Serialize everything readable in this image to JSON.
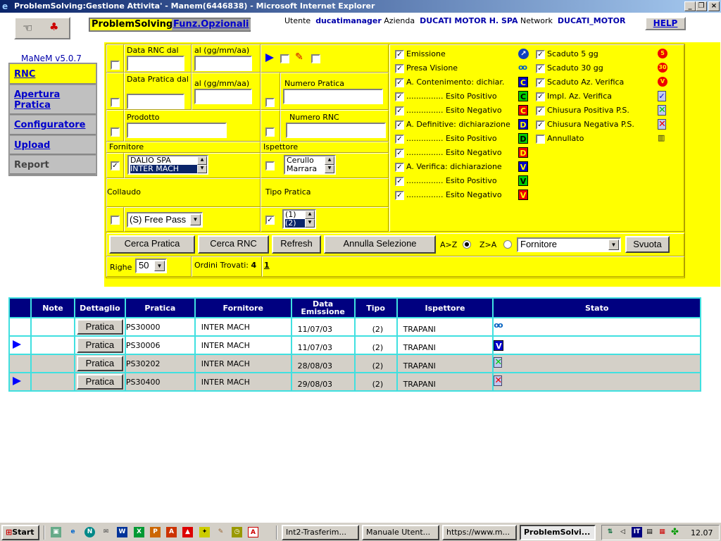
{
  "window": {
    "title": "ProblemSolving:Gestione Attivita' - Manem(6446838) - Microsoft Internet Explorer",
    "minimize": "_",
    "maximize": "❐",
    "close": "×"
  },
  "header": {
    "tab_active": "ProblemSolving",
    "tab_link": "Funz.Opzionali",
    "user_label": "Utente",
    "user": "ducatimanager",
    "company_label": "Azienda",
    "company": "DUCATI MOTOR H. SPA",
    "network_label": "Network",
    "network": "DUCATI_MOTOR",
    "help": "HELP"
  },
  "sidebar": {
    "version": "MaNeM v5.0.7",
    "items": [
      {
        "label": "RNC",
        "active": true
      },
      {
        "label": "Apertura Pratica"
      },
      {
        "label": "Configuratore"
      },
      {
        "label": "Upload"
      },
      {
        "label": "Report",
        "disabled": true
      }
    ]
  },
  "filters": {
    "data_rnc_dal": "Data RNC dal",
    "al1": "al (gg/mm/aa)",
    "data_pratica_dal": "Data Pratica dal",
    "al2": "al (gg/mm/aa)",
    "numero_pratica": "Numero Pratica",
    "prodotto": "Prodotto",
    "numero_rnc": "Numero RNC",
    "fornitore": "Fornitore",
    "fornitore_options": [
      "DALIO SPA",
      "INTER MACH"
    ],
    "fornitore_selected": "INTER MACH",
    "ispettore": "Ispettore",
    "ispettore_options": [
      "Cerullo",
      "Marrara"
    ],
    "collaudo": "Collaudo",
    "collaudo_value": "(S) Free Pass",
    "tipo_pratica": "Tipo Pratica",
    "tipo_options": [
      "(1)",
      "(2)"
    ],
    "tipo_selected": "(2)"
  },
  "status_left": [
    {
      "label": "Emissione",
      "checked": true,
      "icon": "emission-arrow-icon"
    },
    {
      "label": "Presa Visione",
      "checked": true,
      "icon": "glasses-icon"
    },
    {
      "label": "A. Contenimento: dichiar.",
      "checked": true,
      "icon": "C",
      "color": "#0000cc"
    },
    {
      "label": "............... Esito Positivo",
      "checked": true,
      "icon": "C",
      "color": "#00cc00"
    },
    {
      "label": "............... Esito Negativo",
      "checked": true,
      "icon": "C",
      "color": "#ee0000"
    },
    {
      "label": "A. Definitive: dichiarazione",
      "checked": true,
      "icon": "D",
      "color": "#0000cc"
    },
    {
      "label": "............... Esito Positivo",
      "checked": true,
      "icon": "D",
      "color": "#00cc00"
    },
    {
      "label": "............... Esito Negativo",
      "checked": true,
      "icon": "D",
      "color": "#ee0000"
    },
    {
      "label": "A. Verifica: dichiarazione",
      "checked": true,
      "icon": "V",
      "color": "#0000cc"
    },
    {
      "label": "............... Esito Positivo",
      "checked": true,
      "icon": "V",
      "color": "#00cc00"
    },
    {
      "label": "............... Esito Negativo",
      "checked": true,
      "icon": "V",
      "color": "#ee0000"
    }
  ],
  "status_right": [
    {
      "label": "Scaduto 5 gg",
      "checked": true,
      "icon": "5"
    },
    {
      "label": "Scaduto 30 gg",
      "checked": true,
      "icon": "30"
    },
    {
      "label": "Scaduto Az. Verifica",
      "checked": true,
      "icon": "V"
    },
    {
      "label": "Impl. Az. Verifica",
      "checked": true,
      "icon": "check-doc-icon"
    },
    {
      "label": "Chiusura Positiva P.S.",
      "checked": true,
      "icon": "green-x-doc-icon"
    },
    {
      "label": "Chiusura Negativa P.S.",
      "checked": true,
      "icon": "red-x-doc-icon"
    },
    {
      "label": "Annullato",
      "checked": false,
      "icon": "trash-icon"
    }
  ],
  "actions": {
    "cerca_pratica": "Cerca Pratica",
    "cerca_rnc": "Cerca RNC",
    "refresh": "Refresh",
    "annulla": "Annulla Selezione",
    "az": "A>Z",
    "za": "Z>A",
    "sort_selected": "A>Z",
    "sort_field": "Fornitore",
    "svuota": "Svuota",
    "righe_label": "Righe",
    "righe": "50",
    "ordini_label": "Ordini Trovati:",
    "ordini": "4",
    "page": "1"
  },
  "table": {
    "headers": [
      "",
      "Note",
      "Dettaglio",
      "Pratica",
      "Fornitore",
      "Data Emissione",
      "Tipo",
      "Ispettore",
      "Stato"
    ],
    "rows": [
      {
        "marker": false,
        "button": "Pratica",
        "pratica": "PS30000",
        "fornitore": "INTER MACH",
        "data": "11/07/03",
        "tipo": "(2)",
        "ispettore": "TRAPANI",
        "stato": "glasses-icon",
        "bg": "white"
      },
      {
        "marker": true,
        "button": "Pratica",
        "pratica": "PS30006",
        "fornitore": "INTER MACH",
        "data": "11/07/03",
        "tipo": "(2)",
        "ispettore": "TRAPANI",
        "stato": "V",
        "bg": "white"
      },
      {
        "marker": false,
        "button": "Pratica",
        "pratica": "PS30202",
        "fornitore": "INTER MACH",
        "data": "28/08/03",
        "tipo": "(2)",
        "ispettore": "TRAPANI",
        "stato": "green-x-doc-icon",
        "bg": "gray"
      },
      {
        "marker": true,
        "button": "Pratica",
        "pratica": "PS30400",
        "fornitore": "INTER MACH",
        "data": "29/08/03",
        "tipo": "(2)",
        "ispettore": "TRAPANI",
        "stato": "red-x-doc-icon",
        "bg": "gray"
      }
    ]
  },
  "taskbar": {
    "start": "Start",
    "tasks": [
      "Int2-Trasferim...",
      "Manuale Utent...",
      "https://www.m...",
      "ProblemSolvi..."
    ],
    "active_task": "ProblemSolvi...",
    "lang": "IT",
    "clock": "12.07"
  }
}
